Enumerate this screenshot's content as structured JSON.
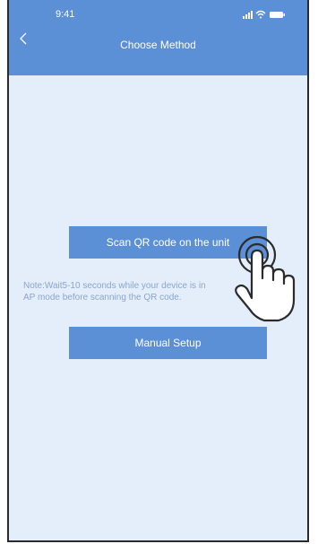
{
  "status_bar": {
    "time": "9:41"
  },
  "header": {
    "title": "Choose Method",
    "back_icon": "chevron-left-icon"
  },
  "main": {
    "scan_button_label": "Scan QR code on the unit",
    "note_line1": "Note:Wait5-10 seconds while your device is in",
    "note_line2": "AP mode before scanning the QR code.",
    "manual_button_label": "Manual Setup"
  },
  "colors": {
    "accent": "#5b8fd6",
    "background": "#e4eefa",
    "note_text": "#8aa6c8"
  },
  "overlay": {
    "icon": "tap-hand-icon"
  }
}
